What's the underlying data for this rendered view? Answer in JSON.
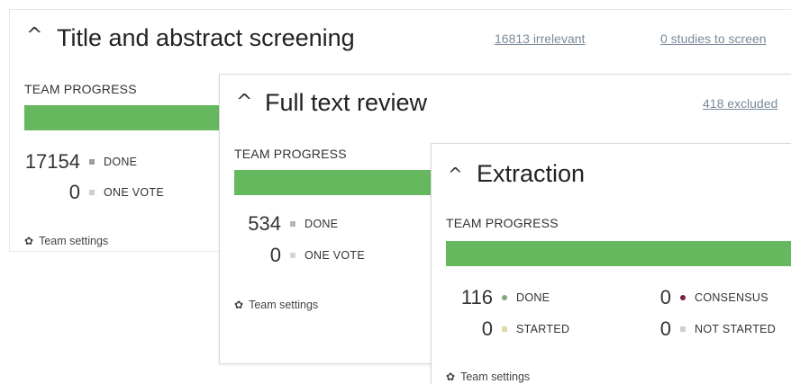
{
  "screening": {
    "title": "Title and abstract screening",
    "irrelevant_link": "16813 irrelevant",
    "to_screen_link": "0 studies to screen",
    "progress_label": "TEAM PROGRESS",
    "progress_fraction": 1.0,
    "stats": [
      {
        "value": "17154",
        "label": "DONE",
        "color": "#9e9e9e"
      },
      {
        "value": "0",
        "label": "ONE VOTE",
        "color": "#cfcfcf"
      }
    ],
    "settings_label": "Team settings"
  },
  "fulltext": {
    "title": "Full text review",
    "excluded_link": "418 excluded",
    "progress_label": "TEAM PROGRESS",
    "progress_fraction": 1.0,
    "stats": [
      {
        "value": "534",
        "label": "DONE",
        "color": "#b5b5b5"
      },
      {
        "value": "0",
        "label": "ONE VOTE",
        "color": "#d6d6d6"
      }
    ],
    "settings_label": "Team settings"
  },
  "extraction": {
    "title": "Extraction",
    "progress_label": "TEAM PROGRESS",
    "progress_fraction": 1.0,
    "stats_left": [
      {
        "value": "116",
        "label": "DONE",
        "color": "#7fa77a"
      },
      {
        "value": "0",
        "label": "STARTED",
        "color": "#e0d9a8"
      }
    ],
    "stats_right": [
      {
        "value": "0",
        "label": "CONSENSUS",
        "color": "#7a1f3d"
      },
      {
        "value": "0",
        "label": "NOT STARTED",
        "color": "#cfcfcf"
      }
    ],
    "settings_label": "Team settings"
  },
  "icons": {
    "collapse": "chevron-up-icon",
    "settings": "gear-icon"
  },
  "colors": {
    "progress_bar": "#66b85f",
    "link": "#7a8a99"
  }
}
